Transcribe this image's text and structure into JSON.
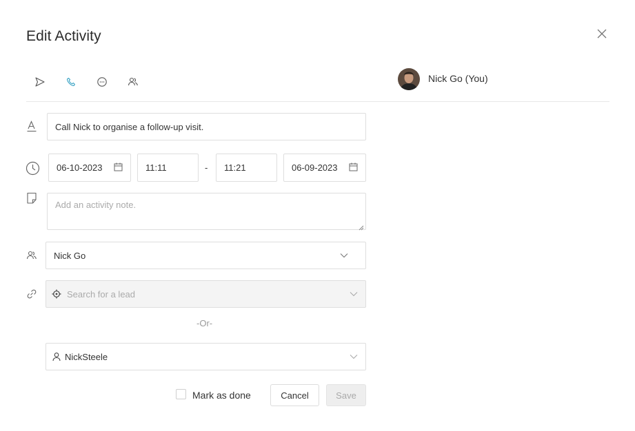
{
  "dialog": {
    "title": "Edit Activity"
  },
  "activity_types": [
    {
      "name": "send-icon"
    },
    {
      "name": "phone-icon",
      "active": true
    },
    {
      "name": "chat-icon"
    },
    {
      "name": "meeting-icon"
    }
  ],
  "owner": {
    "label": "Nick Go (You)"
  },
  "form": {
    "subject": "Call Nick to organise a follow-up visit.",
    "start_date": "06-10-2023",
    "start_time": "11:11",
    "time_separator": "-",
    "end_time": "11:21",
    "end_date": "06-09-2023",
    "note_placeholder": "Add an activity note.",
    "assignee": "Nick Go",
    "lead_placeholder": "Search for a lead",
    "or_text": "-Or-",
    "contact": "NickSteele",
    "mark_done_label": "Mark as done",
    "cancel_label": "Cancel",
    "save_label": "Save"
  },
  "colors": {
    "accent": "#3aa3c4",
    "icon": "#555555"
  }
}
